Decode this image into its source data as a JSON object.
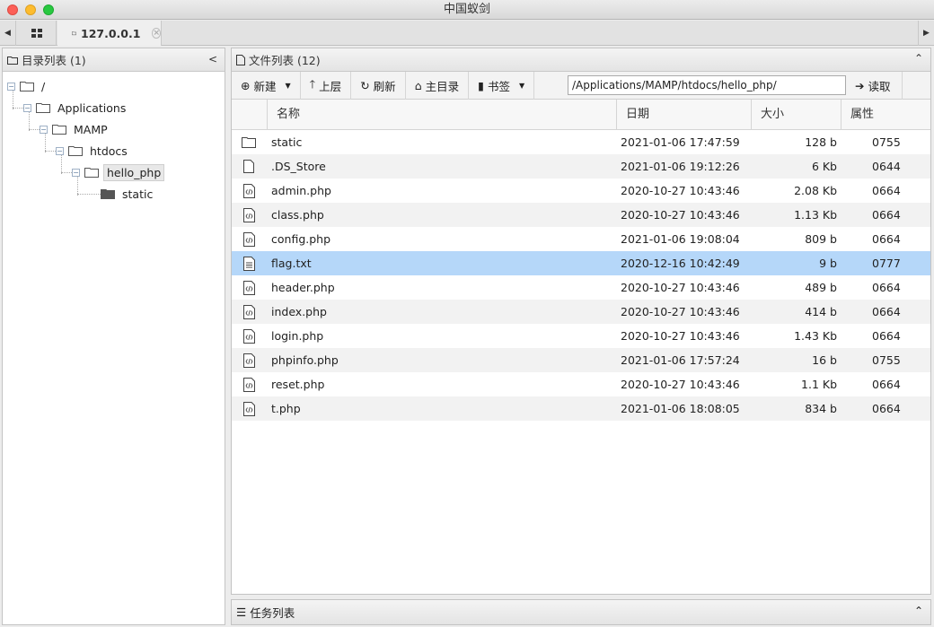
{
  "window": {
    "title": "中国蚁剑"
  },
  "tabs": {
    "host_label": "127.0.0.1"
  },
  "left_panel": {
    "title": "目录列表 (1)",
    "tree": [
      {
        "label": "/"
      },
      {
        "label": "Applications"
      },
      {
        "label": "MAMP"
      },
      {
        "label": "htdocs"
      },
      {
        "label": "hello_php"
      },
      {
        "label": "static"
      }
    ]
  },
  "right_panel": {
    "title": "文件列表 (12)",
    "toolbar": {
      "new_label": "新建",
      "up_label": "上层",
      "refresh_label": "刷新",
      "home_label": "主目录",
      "bookmark_label": "书签",
      "path_value": "/Applications/MAMP/htdocs/hello_php/",
      "read_label": "读取"
    },
    "columns": [
      "名称",
      "日期",
      "大小",
      "属性"
    ],
    "files": [
      {
        "name": "static",
        "date": "2021-01-06 17:47:59",
        "size": "128 b",
        "attr": "0755",
        "icon": "folder-icon"
      },
      {
        "name": ".DS_Store",
        "date": "2021-01-06 19:12:26",
        "size": "6 Kb",
        "attr": "0644",
        "icon": "file-icon"
      },
      {
        "name": "admin.php",
        "date": "2020-10-27 10:43:46",
        "size": "2.08 Kb",
        "attr": "0664",
        "icon": "code-file-icon"
      },
      {
        "name": "class.php",
        "date": "2020-10-27 10:43:46",
        "size": "1.13 Kb",
        "attr": "0664",
        "icon": "code-file-icon"
      },
      {
        "name": "config.php",
        "date": "2021-01-06 19:08:04",
        "size": "809 b",
        "attr": "0664",
        "icon": "code-file-icon"
      },
      {
        "name": "flag.txt",
        "date": "2020-12-16 10:42:49",
        "size": "9 b",
        "attr": "0777",
        "icon": "text-file-icon"
      },
      {
        "name": "header.php",
        "date": "2020-10-27 10:43:46",
        "size": "489 b",
        "attr": "0664",
        "icon": "code-file-icon"
      },
      {
        "name": "index.php",
        "date": "2020-10-27 10:43:46",
        "size": "414 b",
        "attr": "0664",
        "icon": "code-file-icon"
      },
      {
        "name": "login.php",
        "date": "2020-10-27 10:43:46",
        "size": "1.43 Kb",
        "attr": "0664",
        "icon": "code-file-icon"
      },
      {
        "name": "phpinfo.php",
        "date": "2021-01-06 17:57:24",
        "size": "16 b",
        "attr": "0755",
        "icon": "code-file-icon"
      },
      {
        "name": "reset.php",
        "date": "2020-10-27 10:43:46",
        "size": "1.1 Kb",
        "attr": "0664",
        "icon": "code-file-icon"
      },
      {
        "name": "t.php",
        "date": "2021-01-06 18:08:05",
        "size": "834 b",
        "attr": "0664",
        "icon": "code-file-icon"
      }
    ],
    "selected_file": "flag.txt"
  },
  "task_panel": {
    "title": "任务列表"
  },
  "colors": {
    "selection": "#b5d7f9",
    "row_alt": "#f2f2f2"
  }
}
